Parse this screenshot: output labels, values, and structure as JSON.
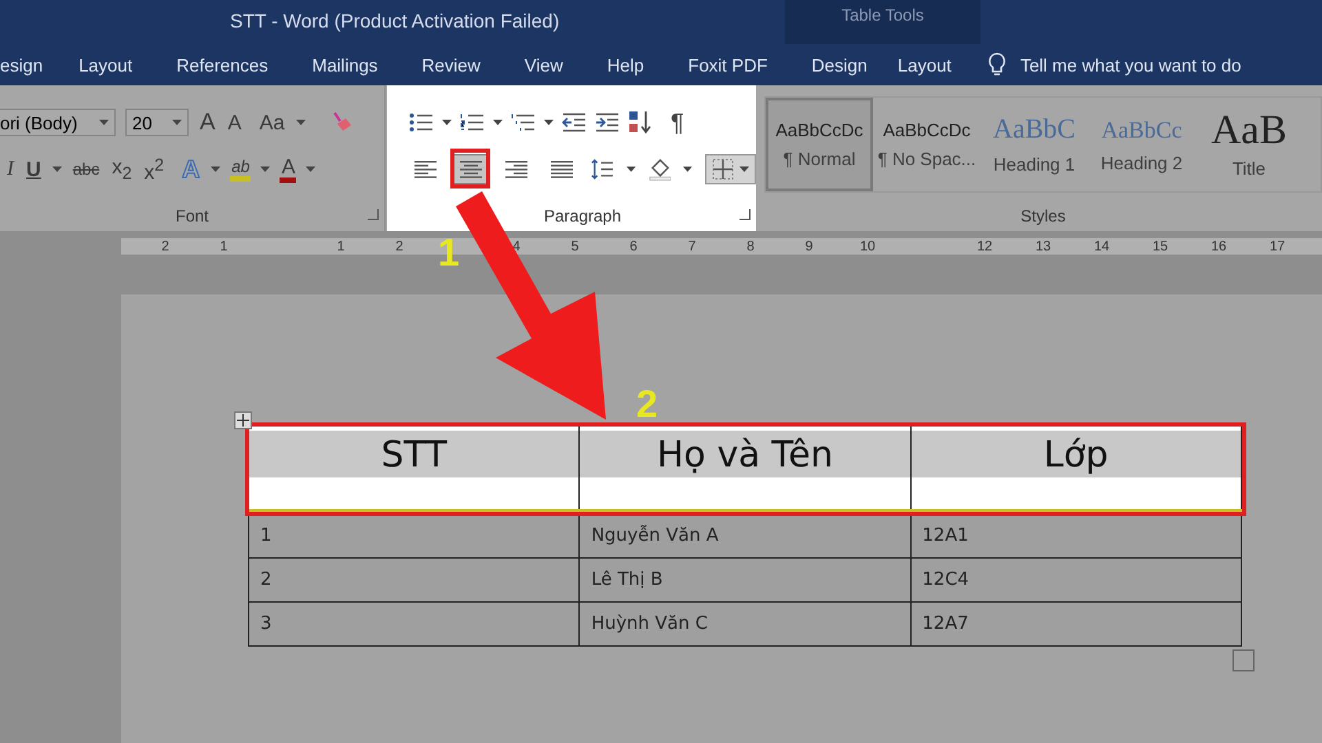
{
  "window": {
    "title": "STT  -  Word (Product Activation Failed)",
    "context_group": "Table Tools"
  },
  "tabs": [
    {
      "label": "esign",
      "kind": "standard",
      "selected": false
    },
    {
      "label": "Layout",
      "kind": "standard",
      "selected": false
    },
    {
      "label": "References",
      "kind": "standard",
      "selected": false
    },
    {
      "label": "Mailings",
      "kind": "standard",
      "selected": false
    },
    {
      "label": "Review",
      "kind": "standard",
      "selected": false
    },
    {
      "label": "View",
      "kind": "standard",
      "selected": false
    },
    {
      "label": "Help",
      "kind": "standard",
      "selected": false
    },
    {
      "label": "Foxit PDF",
      "kind": "standard",
      "selected": false
    },
    {
      "label": "Design",
      "kind": "contextual",
      "selected": false
    },
    {
      "label": "Layout",
      "kind": "contextual",
      "selected": false
    }
  ],
  "tell_me": {
    "placeholder": "Tell me what you want to do"
  },
  "font_group": {
    "label": "Font",
    "font_name": "ori (Body)",
    "font_size": "20",
    "row1": [
      {
        "kind": "grow",
        "label": "A"
      },
      {
        "kind": "shrink",
        "label": "A"
      },
      {
        "kind": "case",
        "label": "Aa"
      },
      {
        "kind": "clear"
      }
    ],
    "row2": [
      {
        "kind": "italic",
        "label": "I"
      },
      {
        "kind": "underline",
        "label": "U"
      },
      {
        "kind": "strike",
        "label": "abc"
      },
      {
        "kind": "subscript",
        "label": "x$_{2}$"
      },
      {
        "kind": "superscript",
        "label": "x$^{2}$"
      },
      {
        "kind": "effects",
        "label": "A"
      },
      {
        "kind": "highlight",
        "label": "ab"
      },
      {
        "kind": "color",
        "label": "A"
      }
    ]
  },
  "paragraph_group": {
    "label": "Paragraph",
    "row1": [
      {
        "kind": "bullets"
      },
      {
        "kind": "numbering"
      },
      {
        "kind": "multilevel"
      },
      {
        "kind": "outdent"
      },
      {
        "kind": "indent"
      },
      {
        "kind": "sort"
      },
      {
        "kind": "marks",
        "label": "¶"
      }
    ],
    "alignment": [
      {
        "kind": "left",
        "selected": false
      },
      {
        "kind": "center",
        "selected": true
      },
      {
        "kind": "right",
        "selected": false
      },
      {
        "kind": "justify",
        "selected": false
      }
    ],
    "row2": [
      {
        "kind": "spacing"
      },
      {
        "kind": "shading"
      },
      {
        "kind": "borders"
      }
    ]
  },
  "styles_group": {
    "label": "Styles",
    "items": [
      {
        "preview": "AaBbCcDc",
        "name": "¶ Normal",
        "kind": "body",
        "selected": true
      },
      {
        "preview": "AaBbCcDc",
        "name": "¶ No Spac...",
        "kind": "body",
        "selected": false
      },
      {
        "preview": "AaBbC",
        "name": "Heading 1",
        "kind": "heading1",
        "selected": false
      },
      {
        "preview": "AaBbCc",
        "name": "Heading 2",
        "kind": "heading2",
        "selected": false
      },
      {
        "preview": "AaB",
        "name": "Title",
        "kind": "title",
        "selected": false
      }
    ]
  },
  "ruler": [
    "2",
    "1",
    "1",
    "2",
    "4",
    "5",
    "6",
    "7",
    "8",
    "9",
    "10",
    "12",
    "13",
    "14",
    "15",
    "16",
    "17"
  ],
  "table": {
    "columns": [
      "STT",
      "Họ và Tên",
      "Lớp"
    ],
    "header_highlighted": true,
    "rows": [
      [
        "1",
        "Nguyễn Văn A",
        "12A1"
      ],
      [
        "2",
        "Lê Thị B",
        "12C4"
      ],
      [
        "3",
        "Huỳnh Văn C",
        "12A7"
      ]
    ]
  },
  "callouts": [
    {
      "label": "1"
    },
    {
      "label": "2"
    }
  ]
}
